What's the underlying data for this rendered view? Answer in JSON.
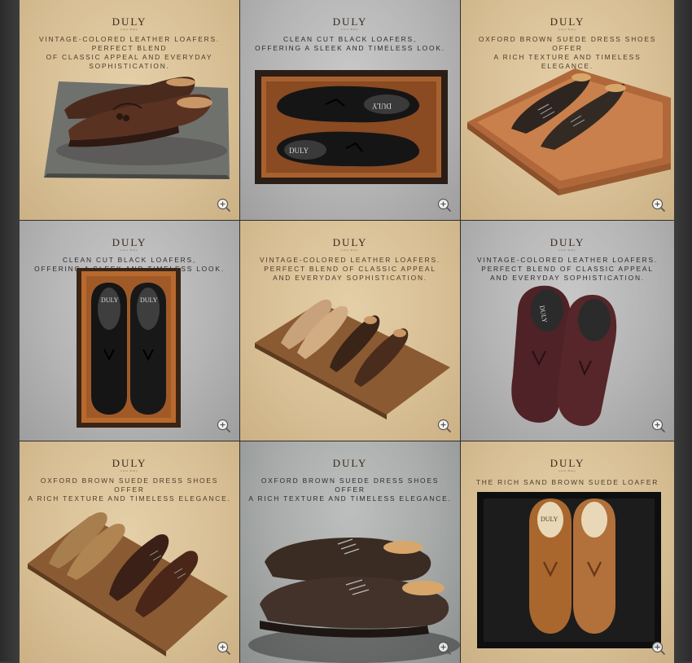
{
  "tiles": [
    {
      "brand": "DULY",
      "sub": "Lois Duly",
      "caption": "VINTAGE-COLORED LEATHER LOAFERS. PERFECT BLEND\nOF CLASSIC APPEAL AND EVERYDAY SOPHISTICATION."
    },
    {
      "brand": "DULY",
      "sub": "Lois Duly",
      "caption": "CLEAN CUT BLACK LOAFERS,\nOFFERING A SLEEK AND TIMELESS LOOK."
    },
    {
      "brand": "DULY",
      "sub": "Lois Duly",
      "caption": "OXFORD BROWN SUEDE DRESS SHOES OFFER\nA RICH TEXTURE AND TIMELESS ELEGANCE."
    },
    {
      "brand": "DULY",
      "sub": "Lois Duly",
      "caption": "CLEAN CUT BLACK LOAFERS,\nOFFERING A SLEEK AND TIMELESS LOOK."
    },
    {
      "brand": "DULY",
      "sub": "Lois Duly",
      "caption": "VINTAGE-COLORED LEATHER LOAFERS.\nPERFECT BLEND OF CLASSIC APPEAL\nAND EVERYDAY SOPHISTICATION."
    },
    {
      "brand": "DULY",
      "sub": "Lois Duly",
      "caption": "VINTAGE-COLORED LEATHER LOAFERS.\nPERFECT BLEND OF CLASSIC APPEAL\nAND EVERYDAY SOPHISTICATION."
    },
    {
      "brand": "DULY",
      "sub": "Lois Duly",
      "caption": "OXFORD BROWN SUEDE DRESS SHOES OFFER\nA RICH TEXTURE AND TIMELESS ELEGANCE."
    },
    {
      "brand": "DULY",
      "sub": "",
      "caption": "OXFORD BROWN SUEDE DRESS SHOES OFFER\nA RICH TEXTURE AND TIMELESS ELEGANCE."
    },
    {
      "brand": "DULY",
      "sub": "Lois Duly",
      "caption": "THE RICH SAND BROWN SUEDE LOAFER"
    }
  ],
  "shoe_labels": {
    "box_lid": "DULY",
    "insole": "DULY"
  },
  "icons": {
    "zoom": "zoom-in-icon"
  },
  "colors": {
    "beige_bg": "#d9c096",
    "grey_bg": "#b4b4b4",
    "frame": "#3d3d3d"
  }
}
